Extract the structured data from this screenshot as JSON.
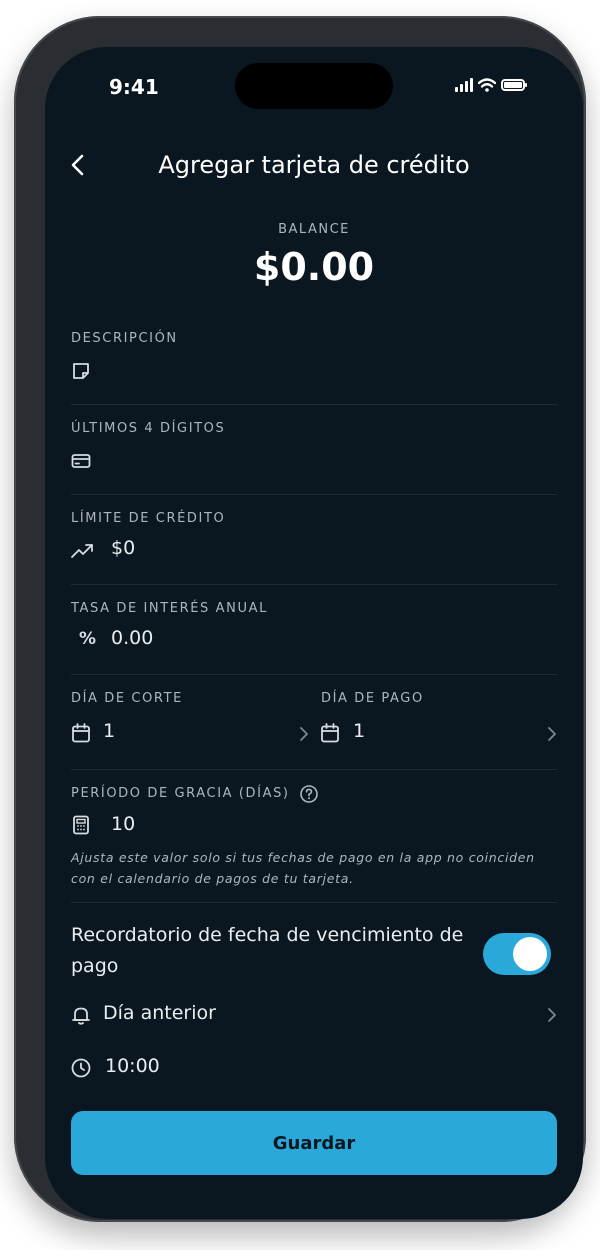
{
  "status_bar": {
    "time": "9:41"
  },
  "header": {
    "title": "Agregar tarjeta de crédito",
    "back_icon": "chevron-left-icon"
  },
  "balance": {
    "label": "BALANCE",
    "value": "$0.00"
  },
  "fields": {
    "description": {
      "label": "DESCRIPCIÓN",
      "value": "",
      "icon": "note-icon"
    },
    "last_digits": {
      "label": "ÚLTIMOS 4 DÍGITOS",
      "value": "",
      "icon": "credit-card-icon"
    },
    "credit_limit": {
      "label": "LÍMITE DE CRÉDITO",
      "value": "$0",
      "icon": "trending-up-icon"
    },
    "interest_rate": {
      "label": "TASA DE INTERÉS ANUAL",
      "value": "0.00",
      "icon": "percent-icon"
    },
    "cut_day": {
      "label": "DÍA DE CORTE",
      "value": "1",
      "icon": "calendar-icon"
    },
    "pay_day": {
      "label": "DÍA DE PAGO",
      "value": "1",
      "icon": "calendar-icon"
    },
    "grace_period": {
      "label": "PERÍODO DE GRACIA (DÍAS)",
      "value": "10",
      "icon": "calculator-icon",
      "help": "Ajusta este valor solo si tus fechas de pago en la app no coinciden con el calendario de pagos de tu tarjeta."
    }
  },
  "reminder": {
    "label": "Recordatorio de fecha de vencimiento de pago",
    "enabled": true,
    "when": "Día anterior",
    "time": "10:00"
  },
  "footer": {
    "save_label": "Guardar"
  },
  "colors": {
    "background": "#0b1720",
    "accent": "#2aa8d9",
    "text": "#e9edf0",
    "muted": "#aeb6bd"
  }
}
